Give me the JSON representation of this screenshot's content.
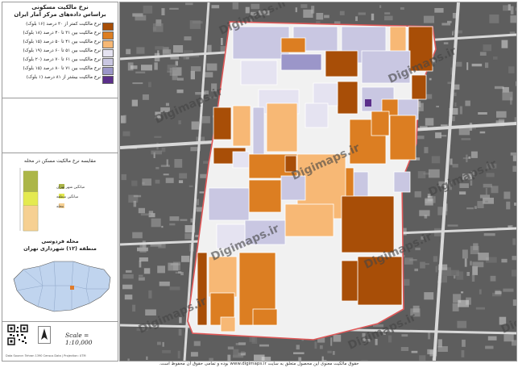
{
  "legend": {
    "title": "نرخ مالکیت مسکونی",
    "subtitle": "براساس داده‌های مرکز آمار ایران",
    "items": [
      {
        "label": "نرخ مالکیت کمتر از ۳۰ درصد (۱۶ بلوک)",
        "color": "#a84e07"
      },
      {
        "label": "نرخ مالکیت بین ۳۱ تا ۴۰ درصد (۱۸ بلوک)",
        "color": "#dc7e22"
      },
      {
        "label": "نرخ مالکیت بین ۴۱ تا ۵۰ درصد (۱۵ بلوک)",
        "color": "#f7b875"
      },
      {
        "label": "نرخ مالکیت بین ۵۱ تا ۶۰ درصد (۱۹ بلوک)",
        "color": "#e5e3f1"
      },
      {
        "label": "نرخ مالکیت بین ۶۱ تا ۷۰ درصد (۲۰ بلوک)",
        "color": "#c9c7e2"
      },
      {
        "label": "نرخ مالکیت بین ۷۱ تا ۸۰ درصد (۱۵ بلوک)",
        "color": "#9b96c9"
      },
      {
        "label": "نرخ مالکیت بیشتر از ۸۱ درصد (۱ بلوک)",
        "color": "#5b2f8a"
      }
    ]
  },
  "chart_data": {
    "type": "bar",
    "title": "مقایسه نرخ مالکیت مسکن در محله",
    "categories": [
      "میانگین شهر تهران",
      "میانگین منطقه",
      "محله"
    ],
    "colors": [
      "#acb648",
      "#e4ea50",
      "#f6d092"
    ],
    "values": [
      0.95,
      0.62,
      0.4
    ],
    "ylim": [
      0,
      1
    ]
  },
  "location": {
    "title": "محله فردوسی",
    "subtitle": "منطقه (۱۲) شهرداری تهران",
    "fill": "#c0d4ee",
    "highlight": "#e07b2a"
  },
  "footer_panel": {
    "scale": "Scale = 1:10,000",
    "north": "N",
    "credit": "Data Source: Tehran 1390 Census Data | Projection: UTM"
  },
  "watermark": "Digimaps.ir",
  "footer_text": "حقوق مالکیت معنوی این محصول متعلق به سایت www.digimaps.ir بوده و تمامی حقوق آن محفوظ است.",
  "map": {
    "boundary_color": "#e05757",
    "background": "#5e5e5e",
    "inner_bg": "#f1f1f1"
  }
}
